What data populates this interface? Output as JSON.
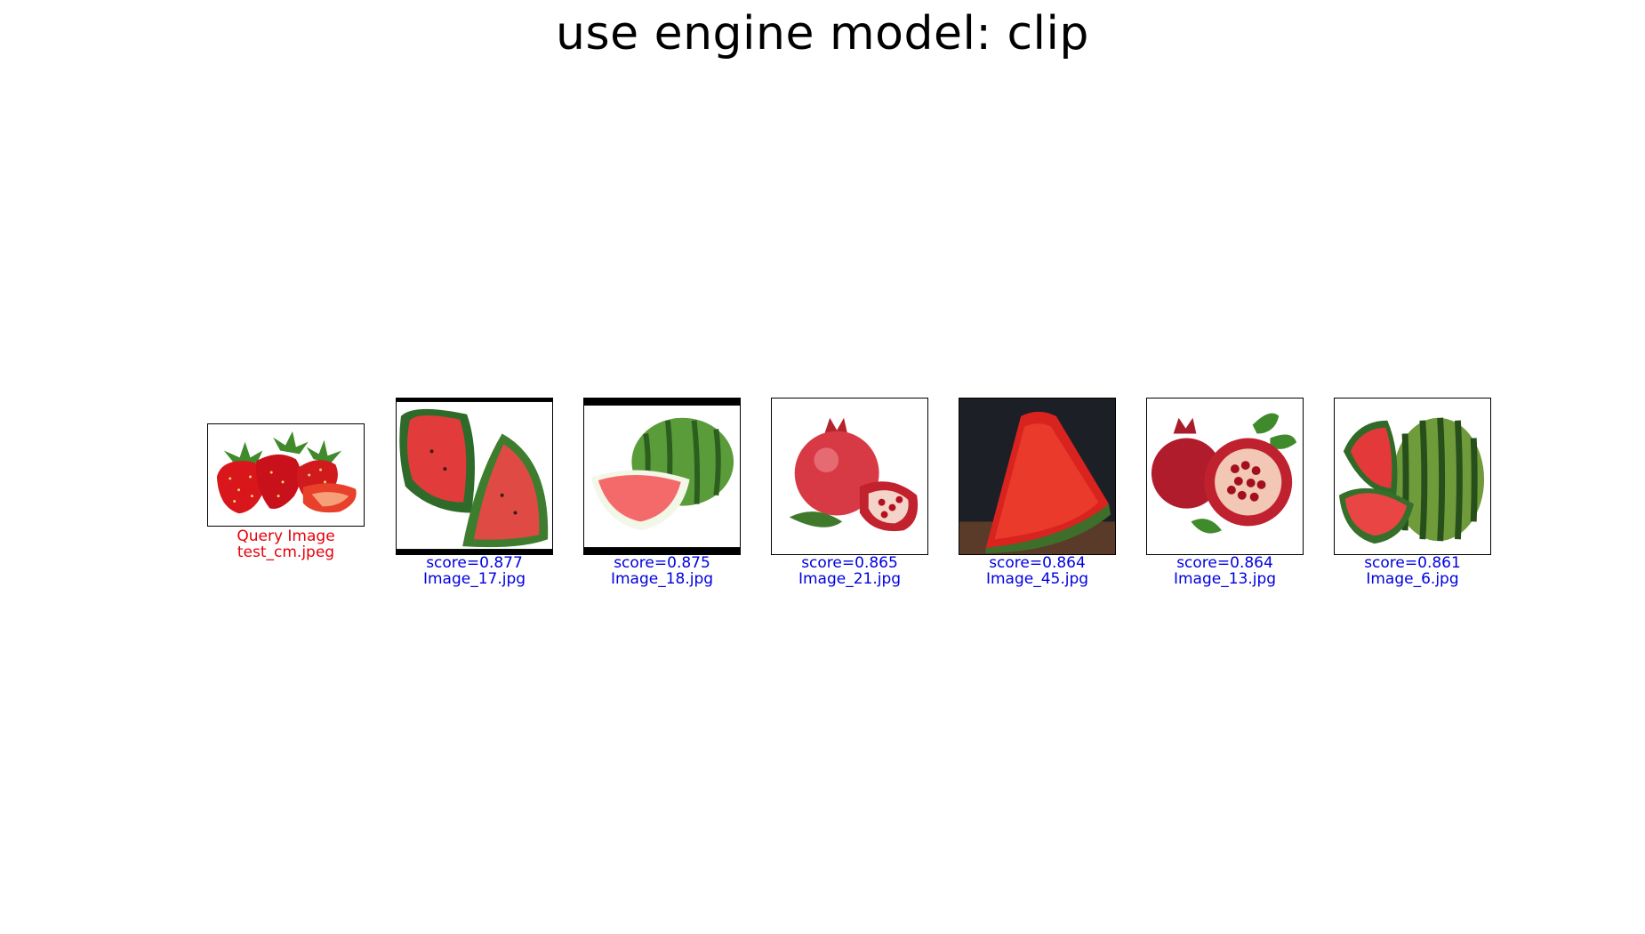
{
  "title": "use engine model: clip",
  "query": {
    "label": "Query Image",
    "filename": "test_cm.jpeg",
    "subject": "strawberries",
    "color": "#e8000b"
  },
  "results": [
    {
      "score": "score=0.877",
      "filename": "Image_17.jpg",
      "subject": "watermelon-slices"
    },
    {
      "score": "score=0.875",
      "filename": "Image_18.jpg",
      "subject": "watermelon-whole-and-slice"
    },
    {
      "score": "score=0.865",
      "filename": "Image_21.jpg",
      "subject": "pomegranate"
    },
    {
      "score": "score=0.864",
      "filename": "Image_45.jpg",
      "subject": "watermelon-wedge-dark"
    },
    {
      "score": "score=0.864",
      "filename": "Image_13.jpg",
      "subject": "pomegranate-open"
    },
    {
      "score": "score=0.861",
      "filename": "Image_6.jpg",
      "subject": "watermelon-whole-and-wedge"
    }
  ],
  "result_color": "#0000e0"
}
